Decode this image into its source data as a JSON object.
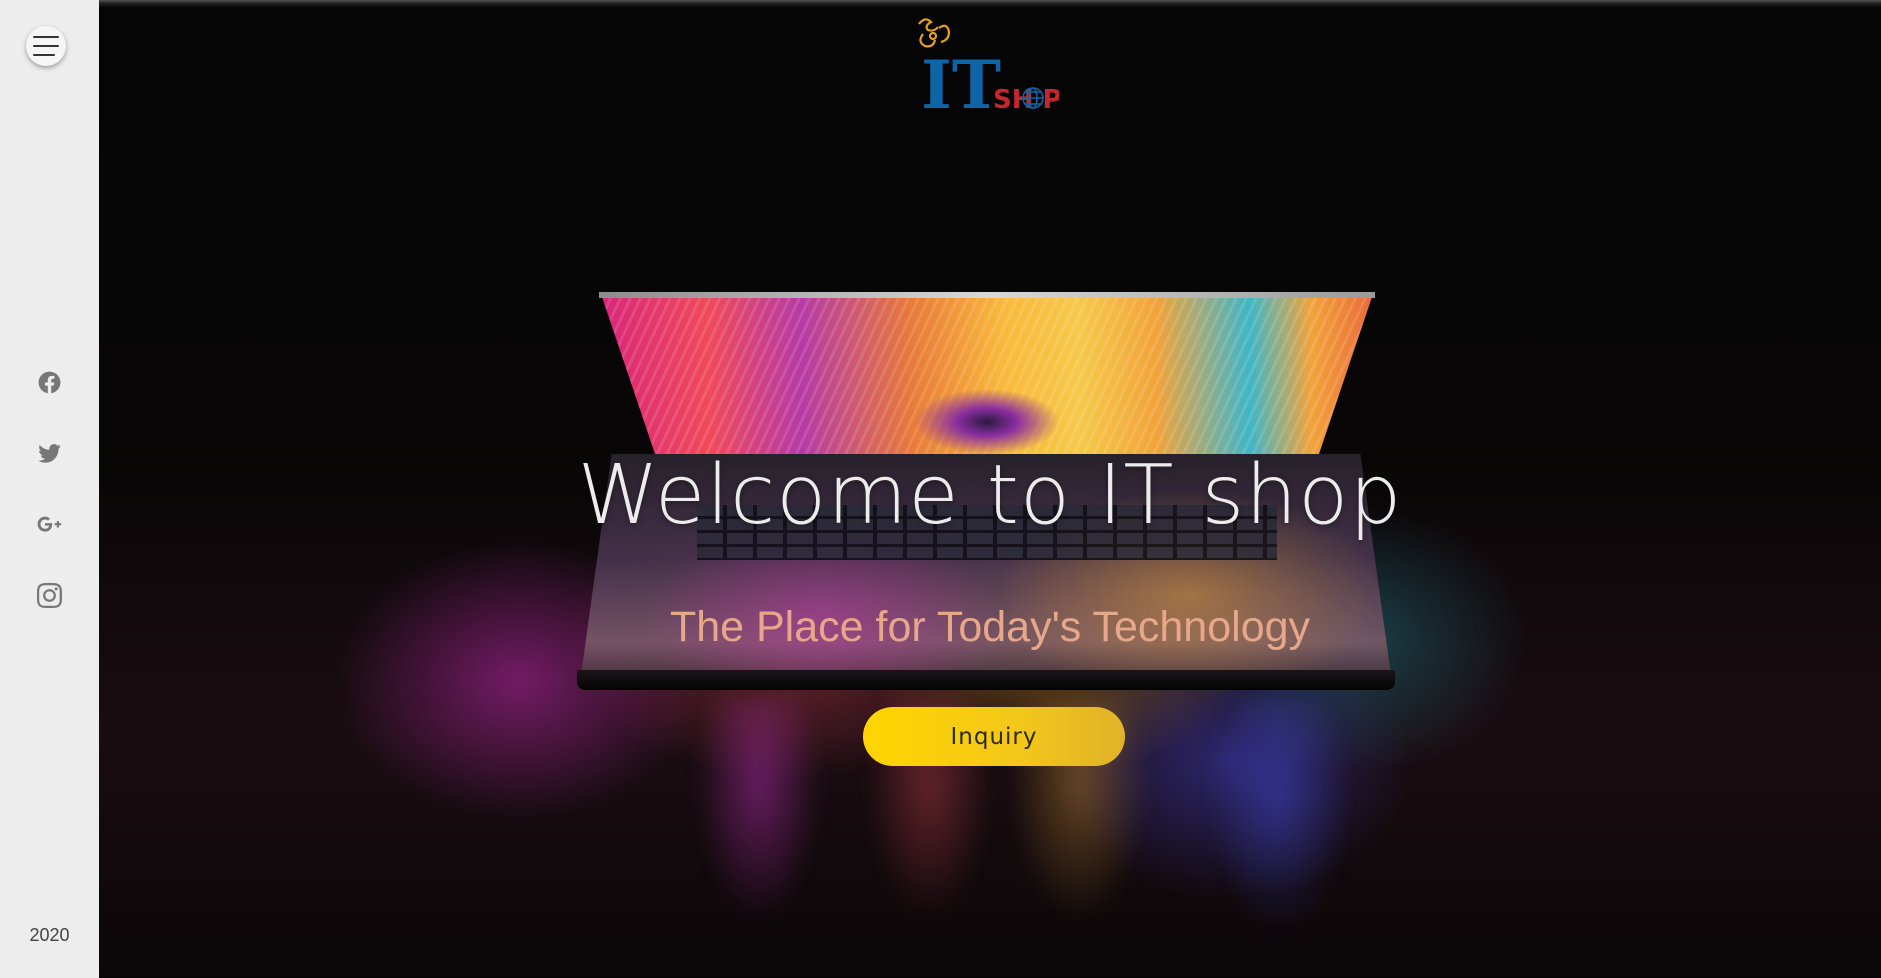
{
  "sidebar": {
    "social": [
      {
        "icon": "facebook-icon"
      },
      {
        "icon": "twitter-icon"
      },
      {
        "icon": "google-plus-icon"
      },
      {
        "icon": "instagram-icon"
      }
    ],
    "year": "2020"
  },
  "logo": {
    "big": "IT",
    "small": "SH P",
    "colors": {
      "big": "#0d64a6",
      "small": "#c1272d",
      "ornament": "#e3a21a"
    }
  },
  "hero": {
    "headline": "Welcome to IT shop",
    "tagline": "The Place for Today's Technology",
    "button_label": "Inquiry",
    "button_color": "#ffd500"
  }
}
